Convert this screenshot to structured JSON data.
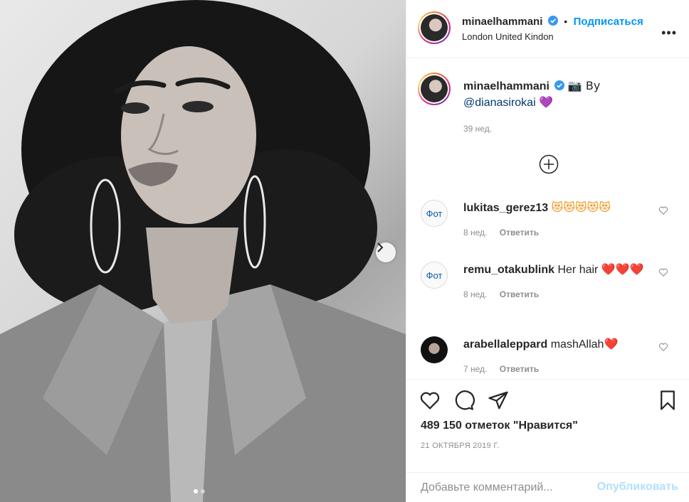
{
  "post": {
    "username": "minaelhammani",
    "follow_dot": "•",
    "follow_label": "Подписаться",
    "location": "London United Kindon",
    "more_label": "•••",
    "caption_text_before": " 📷 By",
    "caption_mention": "@dianasirokai",
    "caption_emoji": "💜",
    "caption_time": "39 нед.",
    "likes": "489 150 отметок \"Нравится\"",
    "date": "21 ОКТЯБРЯ 2019 Г.",
    "image_dots": {
      "count": 2,
      "active_index": 0
    }
  },
  "comments": [
    {
      "username": "lukitas_gerez13",
      "avatar_text": "Фот",
      "text": "",
      "emoji": "😻😻😻😻😻",
      "emoji_class": "emo-cat",
      "time": "8 нед.",
      "reply_label": "Ответить"
    },
    {
      "username": "remu_otakublink",
      "avatar_text": "Фот",
      "text": " Her hair ",
      "emoji": "❤️❤️❤️",
      "emoji_class": "emo-heart",
      "time": "8 нед.",
      "reply_label": "Ответить"
    },
    {
      "username": "arabellaleppard",
      "avatar_text": "",
      "text": " mashAllah",
      "emoji": "❤️",
      "emoji_class": "emo-heart",
      "time": "7 нед.",
      "reply_label": "Ответить"
    }
  ],
  "add_comment": {
    "placeholder": "Добавьте комментарий...",
    "publish_label": "Опубликовать"
  },
  "colors": {
    "accent": "#0095f6",
    "verified": "#3897f0",
    "publish_disabled": "#b2dffc",
    "meta_gray": "#8e8e8e"
  },
  "icons": [
    "verified-badge-icon",
    "add-circle-icon",
    "heart-icon",
    "comment-icon",
    "share-icon",
    "bookmark-icon",
    "chevron-right-icon"
  ]
}
